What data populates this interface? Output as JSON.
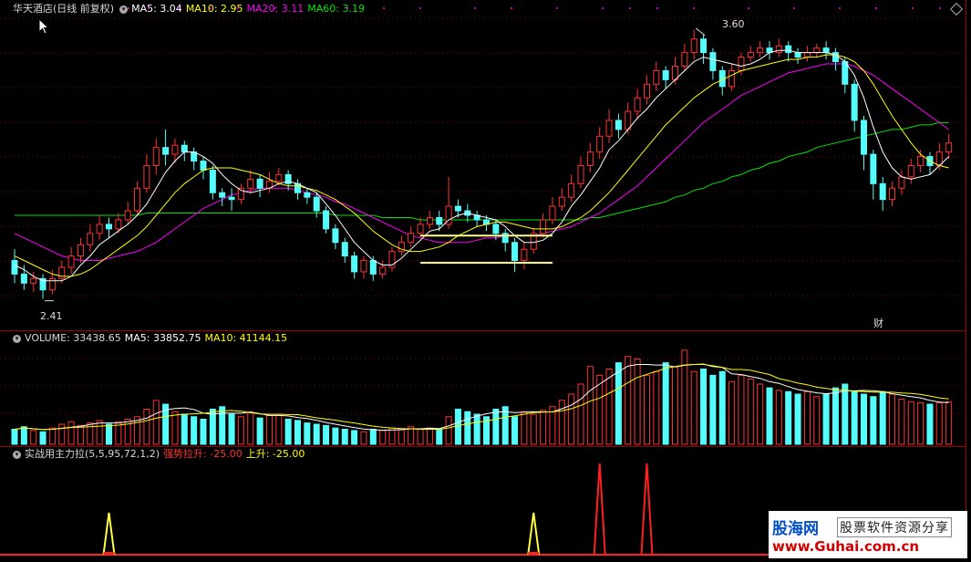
{
  "main_header": {
    "stock": "华天酒店(日线 前复权)",
    "ma5": "MA5: 3.04",
    "ma10": "MA10: 2.95",
    "ma20": "MA20: 3.11",
    "ma60": "MA60: 3.19"
  },
  "annotations": {
    "high": "3.60",
    "low": "2.41",
    "cai": "财"
  },
  "volume_header": {
    "title": "VOLUME: 33438.65",
    "ma5": "MA5: 33852.75",
    "ma10": "MA10: 41144.15"
  },
  "indicator_header": {
    "title": "实战用主力拉(5,5,95,72,1,2)",
    "strong": "强势拉升: -25.00",
    "rise": "上升: -25.00"
  },
  "watermark": {
    "logo": "股海网",
    "slogan": "股票软件资源分享",
    "url": "www.Guhai.com.cn"
  },
  "colors": {
    "up": "#ff3232",
    "down": "#54fcfc",
    "ma5": "#ffffff",
    "ma10": "#ffff00",
    "ma20": "#ff00ff",
    "ma60": "#00e600",
    "grid": "#8b0000"
  },
  "chart_data": {
    "type": "candlestick",
    "y_range": [
      2.41,
      3.6
    ],
    "candles": [
      [
        2.58,
        2.52,
        2.63,
        2.48
      ],
      [
        2.52,
        2.48,
        2.56,
        2.45
      ],
      [
        2.48,
        2.5,
        2.53,
        2.44
      ],
      [
        2.5,
        2.45,
        2.52,
        2.41
      ],
      [
        2.45,
        2.5,
        2.54,
        2.43
      ],
      [
        2.5,
        2.55,
        2.58,
        2.48
      ],
      [
        2.55,
        2.6,
        2.64,
        2.52
      ],
      [
        2.6,
        2.65,
        2.68,
        2.57
      ],
      [
        2.65,
        2.7,
        2.74,
        2.62
      ],
      [
        2.7,
        2.74,
        2.78,
        2.67
      ],
      [
        2.74,
        2.72,
        2.77,
        2.68
      ],
      [
        2.72,
        2.76,
        2.79,
        2.7
      ],
      [
        2.76,
        2.8,
        2.84,
        2.74
      ],
      [
        2.8,
        2.9,
        2.93,
        2.78
      ],
      [
        2.9,
        3.0,
        3.05,
        2.88
      ],
      [
        3.0,
        3.08,
        3.12,
        2.96
      ],
      [
        3.08,
        3.05,
        3.16,
        3.0
      ],
      [
        3.05,
        3.09,
        3.12,
        3.01
      ],
      [
        3.09,
        3.06,
        3.11,
        3.02
      ],
      [
        3.06,
        3.02,
        3.08,
        2.98
      ],
      [
        3.02,
        2.98,
        3.04,
        2.94
      ],
      [
        2.98,
        2.88,
        3.0,
        2.85
      ],
      [
        2.88,
        2.86,
        2.9,
        2.82
      ],
      [
        2.86,
        2.85,
        2.9,
        2.8
      ],
      [
        2.85,
        2.9,
        2.92,
        2.83
      ],
      [
        2.9,
        2.94,
        2.98,
        2.88
      ],
      [
        2.94,
        2.9,
        2.96,
        2.86
      ],
      [
        2.9,
        2.93,
        2.97,
        2.88
      ],
      [
        2.93,
        2.96,
        2.99,
        2.91
      ],
      [
        2.96,
        2.92,
        2.98,
        2.89
      ],
      [
        2.92,
        2.88,
        2.94,
        2.85
      ],
      [
        2.88,
        2.86,
        2.9,
        2.83
      ],
      [
        2.86,
        2.8,
        2.88,
        2.77
      ],
      [
        2.8,
        2.72,
        2.82,
        2.7
      ],
      [
        2.72,
        2.66,
        2.74,
        2.63
      ],
      [
        2.66,
        2.6,
        2.68,
        2.57
      ],
      [
        2.6,
        2.53,
        2.62,
        2.5
      ],
      [
        2.53,
        2.58,
        2.6,
        2.5
      ],
      [
        2.58,
        2.52,
        2.6,
        2.49
      ],
      [
        2.52,
        2.55,
        2.58,
        2.5
      ],
      [
        2.55,
        2.62,
        2.64,
        2.53
      ],
      [
        2.62,
        2.66,
        2.69,
        2.6
      ],
      [
        2.66,
        2.7,
        2.73,
        2.64
      ],
      [
        2.7,
        2.74,
        2.77,
        2.68
      ],
      [
        2.74,
        2.77,
        2.8,
        2.72
      ],
      [
        2.77,
        2.74,
        2.8,
        2.71
      ],
      [
        2.74,
        2.82,
        2.95,
        2.72
      ],
      [
        2.82,
        2.8,
        2.85,
        2.77
      ],
      [
        2.8,
        2.78,
        2.83,
        2.75
      ],
      [
        2.78,
        2.76,
        2.8,
        2.73
      ],
      [
        2.76,
        2.74,
        2.78,
        2.71
      ],
      [
        2.74,
        2.7,
        2.76,
        2.67
      ],
      [
        2.7,
        2.66,
        2.72,
        2.62
      ],
      [
        2.66,
        2.58,
        2.68,
        2.53
      ],
      [
        2.58,
        2.63,
        2.66,
        2.54
      ],
      [
        2.63,
        2.7,
        2.72,
        2.61
      ],
      [
        2.7,
        2.76,
        2.79,
        2.68
      ],
      [
        2.76,
        2.82,
        2.86,
        2.74
      ],
      [
        2.82,
        2.86,
        2.9,
        2.8
      ],
      [
        2.86,
        2.92,
        2.96,
        2.84
      ],
      [
        2.92,
        3.0,
        3.04,
        2.9
      ],
      [
        3.0,
        3.06,
        3.1,
        2.97
      ],
      [
        3.06,
        3.13,
        3.17,
        3.03
      ],
      [
        3.13,
        3.2,
        3.25,
        3.1
      ],
      [
        3.2,
        3.16,
        3.23,
        3.12
      ],
      [
        3.16,
        3.24,
        3.28,
        3.14
      ],
      [
        3.24,
        3.3,
        3.34,
        3.21
      ],
      [
        3.3,
        3.36,
        3.4,
        3.27
      ],
      [
        3.36,
        3.42,
        3.46,
        3.33
      ],
      [
        3.42,
        3.38,
        3.44,
        3.34
      ],
      [
        3.38,
        3.44,
        3.48,
        3.36
      ],
      [
        3.44,
        3.5,
        3.54,
        3.42
      ],
      [
        3.5,
        3.56,
        3.6,
        3.47
      ],
      [
        3.56,
        3.5,
        3.58,
        3.45
      ],
      [
        3.5,
        3.42,
        3.52,
        3.38
      ],
      [
        3.42,
        3.35,
        3.44,
        3.31
      ],
      [
        3.35,
        3.42,
        3.45,
        3.33
      ],
      [
        3.42,
        3.48,
        3.5,
        3.4
      ],
      [
        3.48,
        3.5,
        3.53,
        3.46
      ],
      [
        3.5,
        3.52,
        3.55,
        3.48
      ],
      [
        3.52,
        3.5,
        3.55,
        3.47
      ],
      [
        3.5,
        3.53,
        3.56,
        3.48
      ],
      [
        3.53,
        3.5,
        3.55,
        3.46
      ],
      [
        3.5,
        3.48,
        3.52,
        3.45
      ],
      [
        3.48,
        3.5,
        3.53,
        3.46
      ],
      [
        3.5,
        3.52,
        3.54,
        3.48
      ],
      [
        3.52,
        3.5,
        3.55,
        3.47
      ],
      [
        3.5,
        3.46,
        3.52,
        3.42
      ],
      [
        3.46,
        3.36,
        3.48,
        3.32
      ],
      [
        3.36,
        3.2,
        3.38,
        3.15
      ],
      [
        3.2,
        3.05,
        3.22,
        2.98
      ],
      [
        3.05,
        2.92,
        3.07,
        2.85
      ],
      [
        2.92,
        2.85,
        2.95,
        2.8
      ],
      [
        2.85,
        2.9,
        2.93,
        2.82
      ],
      [
        2.9,
        2.95,
        2.98,
        2.87
      ],
      [
        2.95,
        3.0,
        3.03,
        2.92
      ],
      [
        3.0,
        3.04,
        3.07,
        2.97
      ],
      [
        3.04,
        3.0,
        3.06,
        2.96
      ],
      [
        3.0,
        3.06,
        3.1,
        2.98
      ],
      [
        3.06,
        3.1,
        3.14,
        3.03
      ]
    ],
    "ma5": [
      2.56,
      2.54,
      2.51,
      2.49,
      2.49,
      2.49,
      2.51,
      2.56,
      2.6,
      2.65,
      2.68,
      2.71,
      2.74,
      2.78,
      2.83,
      2.9,
      2.97,
      3.02,
      3.06,
      3.06,
      3.04,
      3.01,
      2.96,
      2.92,
      2.89,
      2.88,
      2.89,
      2.9,
      2.92,
      2.93,
      2.92,
      2.9,
      2.88,
      2.83,
      2.78,
      2.72,
      2.66,
      2.62,
      2.58,
      2.56,
      2.56,
      2.59,
      2.63,
      2.67,
      2.71,
      2.72,
      2.76,
      2.78,
      2.79,
      2.78,
      2.77,
      2.76,
      2.73,
      2.69,
      2.66,
      2.66,
      2.67,
      2.7,
      2.75,
      2.82,
      2.87,
      2.93,
      2.99,
      3.07,
      3.11,
      3.16,
      3.21,
      3.25,
      3.3,
      3.34,
      3.38,
      3.42,
      3.46,
      3.48,
      3.47,
      3.46,
      3.45,
      3.44,
      3.45,
      3.47,
      3.5,
      3.51,
      3.51,
      3.5,
      3.5,
      3.5,
      3.5,
      3.49,
      3.46,
      3.4,
      3.3,
      3.17,
      3.06,
      2.99,
      2.95,
      2.94,
      2.95,
      2.96,
      3.0,
      3.04
    ],
    "ma10": [
      2.6,
      2.58,
      2.56,
      2.54,
      2.52,
      2.51,
      2.51,
      2.52,
      2.54,
      2.57,
      2.6,
      2.63,
      2.66,
      2.69,
      2.73,
      2.78,
      2.83,
      2.88,
      2.92,
      2.95,
      2.98,
      2.99,
      2.99,
      2.99,
      2.98,
      2.97,
      2.96,
      2.94,
      2.92,
      2.91,
      2.91,
      2.9,
      2.89,
      2.87,
      2.85,
      2.82,
      2.79,
      2.75,
      2.71,
      2.68,
      2.65,
      2.63,
      2.62,
      2.62,
      2.63,
      2.64,
      2.66,
      2.69,
      2.71,
      2.73,
      2.74,
      2.75,
      2.75,
      2.74,
      2.73,
      2.72,
      2.72,
      2.72,
      2.73,
      2.75,
      2.77,
      2.8,
      2.84,
      2.88,
      2.93,
      2.98,
      3.03,
      3.08,
      3.13,
      3.18,
      3.22,
      3.26,
      3.3,
      3.33,
      3.36,
      3.38,
      3.4,
      3.42,
      3.43,
      3.44,
      3.45,
      3.46,
      3.47,
      3.47,
      3.48,
      3.48,
      3.49,
      3.49,
      3.48,
      3.46,
      3.42,
      3.36,
      3.29,
      3.22,
      3.16,
      3.1,
      3.05,
      3.02,
      3.0,
      2.99
    ],
    "ma20": [
      2.7,
      2.68,
      2.66,
      2.64,
      2.62,
      2.6,
      2.59,
      2.58,
      2.58,
      2.58,
      2.59,
      2.6,
      2.61,
      2.62,
      2.64,
      2.66,
      2.69,
      2.72,
      2.75,
      2.78,
      2.81,
      2.83,
      2.85,
      2.87,
      2.88,
      2.89,
      2.9,
      2.9,
      2.9,
      2.9,
      2.89,
      2.88,
      2.87,
      2.86,
      2.84,
      2.83,
      2.81,
      2.79,
      2.77,
      2.75,
      2.73,
      2.71,
      2.69,
      2.68,
      2.67,
      2.66,
      2.66,
      2.66,
      2.66,
      2.67,
      2.68,
      2.68,
      2.69,
      2.69,
      2.69,
      2.69,
      2.7,
      2.71,
      2.72,
      2.73,
      2.75,
      2.77,
      2.79,
      2.82,
      2.85,
      2.88,
      2.91,
      2.95,
      2.99,
      3.03,
      3.07,
      3.11,
      3.15,
      3.19,
      3.22,
      3.25,
      3.28,
      3.31,
      3.33,
      3.35,
      3.37,
      3.39,
      3.41,
      3.42,
      3.43,
      3.44,
      3.45,
      3.45,
      3.45,
      3.44,
      3.42,
      3.4,
      3.37,
      3.34,
      3.31,
      3.28,
      3.25,
      3.22,
      3.19,
      3.16
    ],
    "ma60": [
      2.78,
      2.78,
      2.78,
      2.78,
      2.78,
      2.78,
      2.78,
      2.78,
      2.78,
      2.78,
      2.78,
      2.78,
      2.78,
      2.78,
      2.79,
      2.79,
      2.79,
      2.79,
      2.79,
      2.79,
      2.79,
      2.79,
      2.79,
      2.79,
      2.79,
      2.79,
      2.79,
      2.79,
      2.79,
      2.79,
      2.79,
      2.79,
      2.79,
      2.79,
      2.78,
      2.78,
      2.78,
      2.78,
      2.78,
      2.77,
      2.77,
      2.77,
      2.77,
      2.76,
      2.76,
      2.76,
      2.76,
      2.76,
      2.76,
      2.76,
      2.76,
      2.76,
      2.76,
      2.76,
      2.76,
      2.76,
      2.76,
      2.76,
      2.76,
      2.76,
      2.76,
      2.77,
      2.77,
      2.78,
      2.79,
      2.8,
      2.81,
      2.82,
      2.83,
      2.84,
      2.86,
      2.87,
      2.89,
      2.9,
      2.92,
      2.93,
      2.95,
      2.96,
      2.98,
      2.99,
      3.01,
      3.02,
      3.04,
      3.05,
      3.06,
      3.08,
      3.09,
      3.1,
      3.11,
      3.12,
      3.13,
      3.14,
      3.15,
      3.16,
      3.16,
      3.17,
      3.18,
      3.18,
      3.19,
      3.19
    ],
    "volume": [
      12,
      14,
      11,
      10,
      13,
      16,
      18,
      15,
      17,
      19,
      16,
      18,
      20,
      22,
      28,
      35,
      32,
      26,
      24,
      22,
      20,
      28,
      30,
      24,
      22,
      25,
      21,
      23,
      24,
      20,
      19,
      17,
      16,
      15,
      13,
      12,
      11,
      10,
      12,
      11,
      13,
      12,
      14,
      12,
      13,
      12,
      22,
      28,
      26,
      24,
      22,
      28,
      30,
      22,
      26,
      24,
      27,
      30,
      35,
      40,
      48,
      62,
      55,
      60,
      65,
      70,
      68,
      55,
      58,
      65,
      62,
      75,
      58,
      60,
      55,
      58,
      50,
      55,
      52,
      48,
      45,
      43,
      42,
      40,
      42,
      38,
      40,
      45,
      48,
      42,
      40,
      38,
      42,
      40,
      36,
      34,
      33,
      32,
      33,
      34
    ],
    "indicator_spikes": [
      {
        "index": 10,
        "value": 1,
        "color": "yellow"
      },
      {
        "index": 55,
        "value": 1,
        "color": "yellow"
      },
      {
        "index": 62,
        "value": 2,
        "color": "red"
      },
      {
        "index": 67,
        "value": 2,
        "color": "red"
      }
    ]
  }
}
